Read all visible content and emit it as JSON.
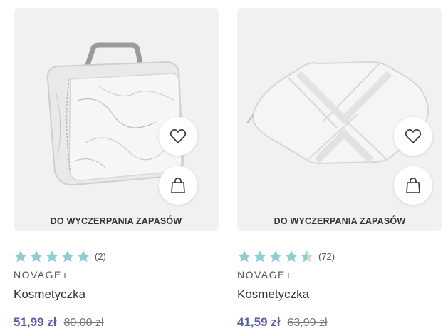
{
  "products": [
    {
      "stock_label": "DO WYCZERPANIA ZAPASÓW",
      "rating_value": 5,
      "rating_count": "(2)",
      "brand": "NOVAGE+",
      "name": "Kosmetyczka",
      "price": "51,99 zł",
      "old_price": "80,00 zł",
      "image_icon": "marble-cosmetic-case"
    },
    {
      "stock_label": "DO WYCZERPANIA ZAPASÓW",
      "rating_value": 4.5,
      "rating_count": "(72)",
      "brand": "NOVAGE+",
      "name": "Kosmetyczka",
      "price": "41,59 zł",
      "old_price": "63,99 zł",
      "image_icon": "white-woven-pouch"
    }
  ],
  "colors": {
    "star": "#8ccfd2",
    "star_empty": "#d6d6d6",
    "price": "#5b5fb0",
    "card_bg": "#f1f1f1"
  },
  "icons": {
    "wishlist": "heart-icon",
    "cart": "shopping-bag-icon"
  }
}
